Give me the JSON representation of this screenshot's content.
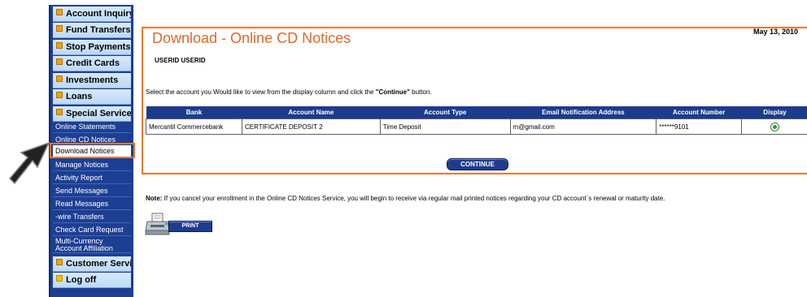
{
  "sidebar": {
    "categories": [
      {
        "label": "Account Inquiry"
      },
      {
        "label": "Fund Transfers"
      },
      {
        "label": "Stop Payments"
      },
      {
        "label": "Credit Cards"
      },
      {
        "label": "Investments"
      },
      {
        "label": "Loans"
      },
      {
        "label": "Special Services"
      },
      {
        "label": "Customer Service"
      },
      {
        "label": "Log off"
      }
    ],
    "special_services_items": [
      {
        "label": "Online Statements"
      },
      {
        "label": "Online CD Notices"
      },
      {
        "label": "Download Notices"
      },
      {
        "label": "Manage Notices"
      },
      {
        "label": "Activity Report"
      },
      {
        "label": "Send Messages"
      },
      {
        "label": "Read Messages"
      },
      {
        "label": "-wire  Transfers"
      },
      {
        "label": "Check Card Request"
      },
      {
        "label": "Multi-Currency Account Affiliation"
      }
    ]
  },
  "main": {
    "title": "Download - Online CD Notices",
    "date": "May 13, 2010",
    "user_id": "USERID USERID",
    "instructions_prefix": "Select the account you Would like to view from the display column and click the ",
    "instructions_bold": "\"Continue\"",
    "instructions_suffix": " button.",
    "table": {
      "headers": [
        "Bank",
        "Account Name",
        "Account Type",
        "Email Notification Address",
        "Account Number",
        "Display"
      ],
      "rows": [
        {
          "bank": "Mercantil Commercebank",
          "account_name": "CERTIFICATE DEPOSIT 2",
          "account_type": "Time Deposit",
          "email": "m@gmail.com",
          "account_number": "******9101",
          "display_selected": true
        }
      ]
    },
    "continue_label": "CONTINUE",
    "note_label": "Note:",
    "note_text": " If you cancel your enrollment in the Online CD Notices Service, you will begin to receive via regular mail printed notices regarding your CD account`s renewal or maturity date.",
    "print_label": "PRINT"
  },
  "colors": {
    "nav_blue": "#1d3f93",
    "header_blue": "#1b3b8b",
    "highlight_orange": "#f0772d",
    "title_orange": "#e8662a"
  }
}
